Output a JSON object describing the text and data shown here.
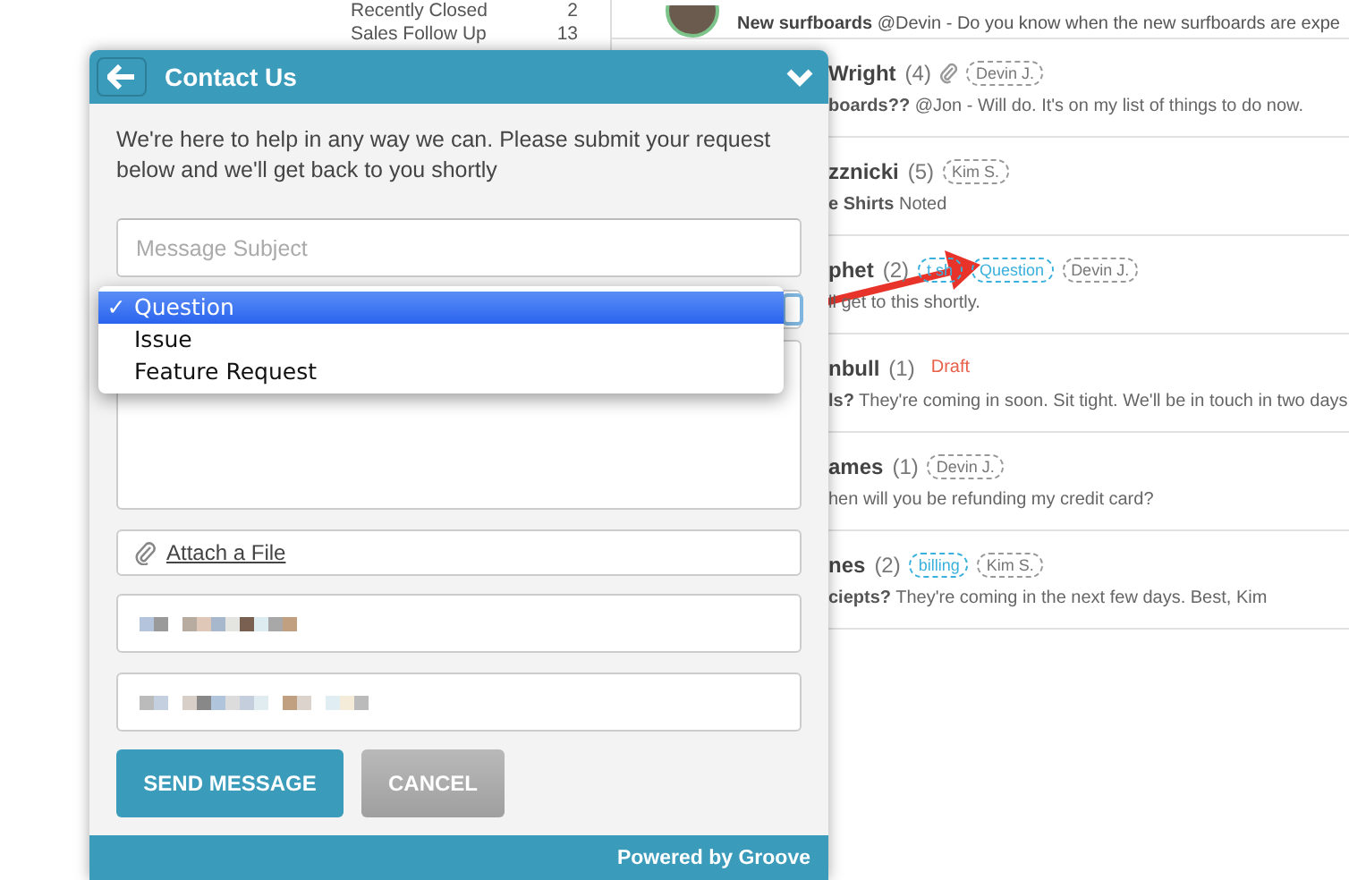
{
  "sidebar": {
    "items": [
      {
        "label": "Recently Closed",
        "count": "2"
      },
      {
        "label": "Sales Follow Up",
        "count": "13"
      }
    ]
  },
  "top_conversation": {
    "preview": "**New surfboards** @Devin - Do you know when the new surfboards are expe"
  },
  "conversations": [
    {
      "name": "Wright",
      "count": "(4)",
      "attachment": true,
      "tags": [
        {
          "label": "Devin J.",
          "kind": "agent"
        }
      ],
      "preview": "**boards??** @Jon - Will do. It's on my list of things to do now."
    },
    {
      "name": "zznicki",
      "count": "(5)",
      "attachment": false,
      "tags": [
        {
          "label": "Kim S.",
          "kind": "agent"
        }
      ],
      "preview": "**e Shirts** Noted"
    },
    {
      "name": "phet",
      "count": "(2)",
      "attachment": false,
      "tags": [
        {
          "label": "t sh",
          "kind": "label"
        },
        {
          "label": "Question",
          "kind": "label"
        },
        {
          "label": "Devin J.",
          "kind": "agent"
        }
      ],
      "preview": "ll get to this shortly."
    },
    {
      "name": "nbull",
      "count": "(1)",
      "attachment": false,
      "tags": [
        {
          "label": "Draft",
          "kind": "draft"
        }
      ],
      "preview": "**ls?** They're coming in soon. Sit tight. We'll be in touch in two days"
    },
    {
      "name": "ames",
      "count": "(1)",
      "attachment": false,
      "tags": [
        {
          "label": "Devin J.",
          "kind": "agent"
        }
      ],
      "preview": "hen will you be refunding my credit card?"
    },
    {
      "name": "nes",
      "count": "(2)",
      "attachment": false,
      "tags": [
        {
          "label": "billing",
          "kind": "label"
        },
        {
          "label": "Kim S.",
          "kind": "agent"
        }
      ],
      "preview": "**ciepts?** They're coming in the next few days. Best, Kim"
    }
  ],
  "widget": {
    "title": "Contact Us",
    "intro": "We're here to help in any way we can. Please submit your request below and we'll get back to you shortly",
    "subject": {
      "placeholder": "Message Subject"
    },
    "selected_mark": "✓",
    "type_menu": [
      {
        "label": "Question",
        "selected": true
      },
      {
        "label": "Issue",
        "selected": false
      },
      {
        "label": "Feature Request",
        "selected": false
      }
    ],
    "attach": "Attach a File",
    "buttons": [
      {
        "label": "SEND MESSAGE",
        "kind": "primary"
      },
      {
        "label": "CANCEL",
        "kind": "secondary"
      }
    ],
    "footer": "Powered by Groove"
  }
}
